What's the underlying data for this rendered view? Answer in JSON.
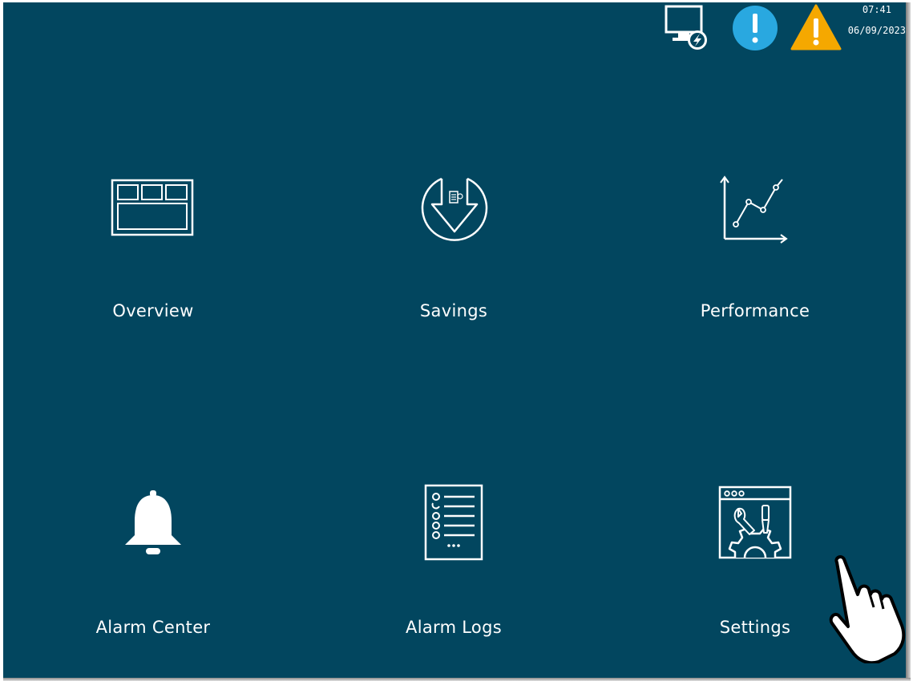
{
  "status_bar": {
    "time": "07:41",
    "date": "06/09/2023",
    "icons": [
      "remote-display-icon",
      "info-alert-icon",
      "warning-icon"
    ],
    "colors": {
      "info": "#29a8e0",
      "warning": "#f5a800"
    }
  },
  "tiles": [
    {
      "label": "Overview",
      "icon": "overview-grid-icon"
    },
    {
      "label": "Savings",
      "icon": "savings-icon"
    },
    {
      "label": "Performance",
      "icon": "performance-chart-icon"
    },
    {
      "label": "Alarm Center",
      "icon": "bell-icon"
    },
    {
      "label": "Alarm Logs",
      "icon": "alarm-log-list-icon"
    },
    {
      "label": "Settings",
      "icon": "settings-tools-icon"
    }
  ],
  "theme": {
    "background": "#02465f",
    "foreground": "#ffffff"
  },
  "cursor": "pointer-hand-icon"
}
